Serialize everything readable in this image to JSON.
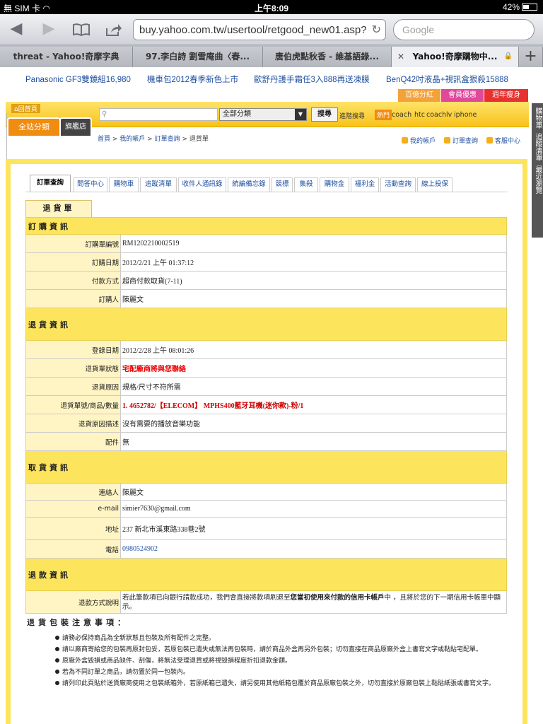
{
  "status": {
    "carrier": "無 SIM 卡",
    "time": "上午8:09",
    "battery": "42%"
  },
  "browser": {
    "url": "buy.yahoo.com.tw/usertool/retgood_new01.asp?",
    "search_placeholder": "Google",
    "tabs": [
      {
        "label": "threat - Yahoo!奇摩字典"
      },
      {
        "label": "97.李白詩 劉雪庵曲〈春..."
      },
      {
        "label": "唐伯虎點秋香 - 維基語錄..."
      },
      {
        "label": "Yahoo!奇摩購物中..."
      }
    ],
    "close_glyph": "✕",
    "new_tab_glyph": "+"
  },
  "promos": [
    "Panasonic GF3雙鏡組16,980",
    "機車包2012春季新色上市",
    "歐舒丹護手霜任3入888再送凍膜",
    "BenQ42吋液晶+視訊盒狠殺15888"
  ],
  "topbuttons": [
    "百億分紅",
    "會員優惠",
    "週年瘦身"
  ],
  "header": {
    "home_label": "回首頁",
    "all_categories": "全站分類",
    "flagship": "旗艦店",
    "category_select": "全部分類",
    "search_button": "搜尋",
    "advanced": "進階搜尋",
    "hot_label": "熱門",
    "hot_words": [
      "coach",
      "htc",
      "coach",
      "lv",
      "iphone"
    ],
    "breadcrumb": {
      "home": "首頁",
      "account": "我的帳戶",
      "orders": "訂單查詢",
      "current": "退貨單",
      "sep": " > "
    },
    "links": [
      "我的帳戶",
      "訂單查詢",
      "客服中心"
    ]
  },
  "sidebar": [
    "購物車",
    "追蹤清單",
    "最近瀏覽"
  ],
  "subtabs": [
    "訂單查詢",
    "問答中心",
    "購物車",
    "追蹤清單",
    "收件人通訊錄",
    "統編備忘錄",
    "競標",
    "集殺",
    "購物金",
    "福利金",
    "活動查詢",
    "線上投保"
  ],
  "doc_tab": "退貨單",
  "sections": {
    "order": {
      "title": "訂購資訊",
      "rows": [
        {
          "k": "訂購單編號",
          "v": "RM1202210002519"
        },
        {
          "k": "訂購日期",
          "v": "2012/2/21 上午 01:37:12"
        },
        {
          "k": "付款方式",
          "v": "超商付款取貨(7-11)"
        },
        {
          "k": "訂購人",
          "v": "陳麗文"
        }
      ]
    },
    "return": {
      "title": "退貨資訊",
      "rows": [
        {
          "k": "登錄日期",
          "v": "2012/2/28 上午 08:01:26"
        },
        {
          "k": "退貨單狀態",
          "v": "宅配廠商將與您聯絡"
        },
        {
          "k": "退貨原因",
          "v": "規格/尺寸不符所需"
        },
        {
          "k": "退貨單號/商品/數量",
          "v": "1. 4652782/【ELECOM】 MPHS400藍牙耳機(迷你款)-粉/1"
        },
        {
          "k": "退貨原因描述",
          "v": "沒有需要的播放音樂功能"
        },
        {
          "k": "配件",
          "v": "無"
        }
      ]
    },
    "pickup": {
      "title": "取貨資訊",
      "rows": [
        {
          "k": "連絡人",
          "v": "陳麗文"
        },
        {
          "k": "e-mail",
          "v": "simier7630@gmail.com"
        },
        {
          "k": "地址",
          "v": "237 新北市溪東路338巷2號"
        },
        {
          "k": "電話",
          "v": "0980524902"
        }
      ]
    },
    "refund": {
      "title": "退款資訊",
      "rows": [
        {
          "k": "退款方式說明",
          "v_pre": "若此筆款項已向銀行請款成功，我們會直接將款項刷退至",
          "v_bold": "您當初使用來付款的信用卡帳戶",
          "v_post": "中 ，且將於您的下一期信用卡帳單中顯示。"
        }
      ]
    }
  },
  "notes": {
    "title": "退貨包裝注意事項：",
    "items": [
      "請務必保持商品為全新狀態且包裝及所有配件之完整。",
      "請以廠商寄給您的包裝再原封包妥，若原包裝已遺失或無法再包裝時，請於商品外盒再另外包裝；切勿直接在商品原廠外盒上書寫文字或黏貼宅配單。",
      "原廠外盒毀損或商品缺件、刮傷，將無法受理退貨或將視毀損程度折扣退款金額。",
      "若為不同訂單之商品，請勿置於同一包裝內。",
      "請列印此頁貼於送貨廠商使用之包裝紙箱外，若原紙箱已遺失，請另使用其他紙箱包覆於商品原廠包裝之外，切勿直接於原廠包裝上黏貼紙張或書寫文字。"
    ]
  },
  "colors": {
    "accent": "#fde45d",
    "link": "#1f4fa0",
    "status_red": "#e00000",
    "orange": "#f08c10"
  }
}
